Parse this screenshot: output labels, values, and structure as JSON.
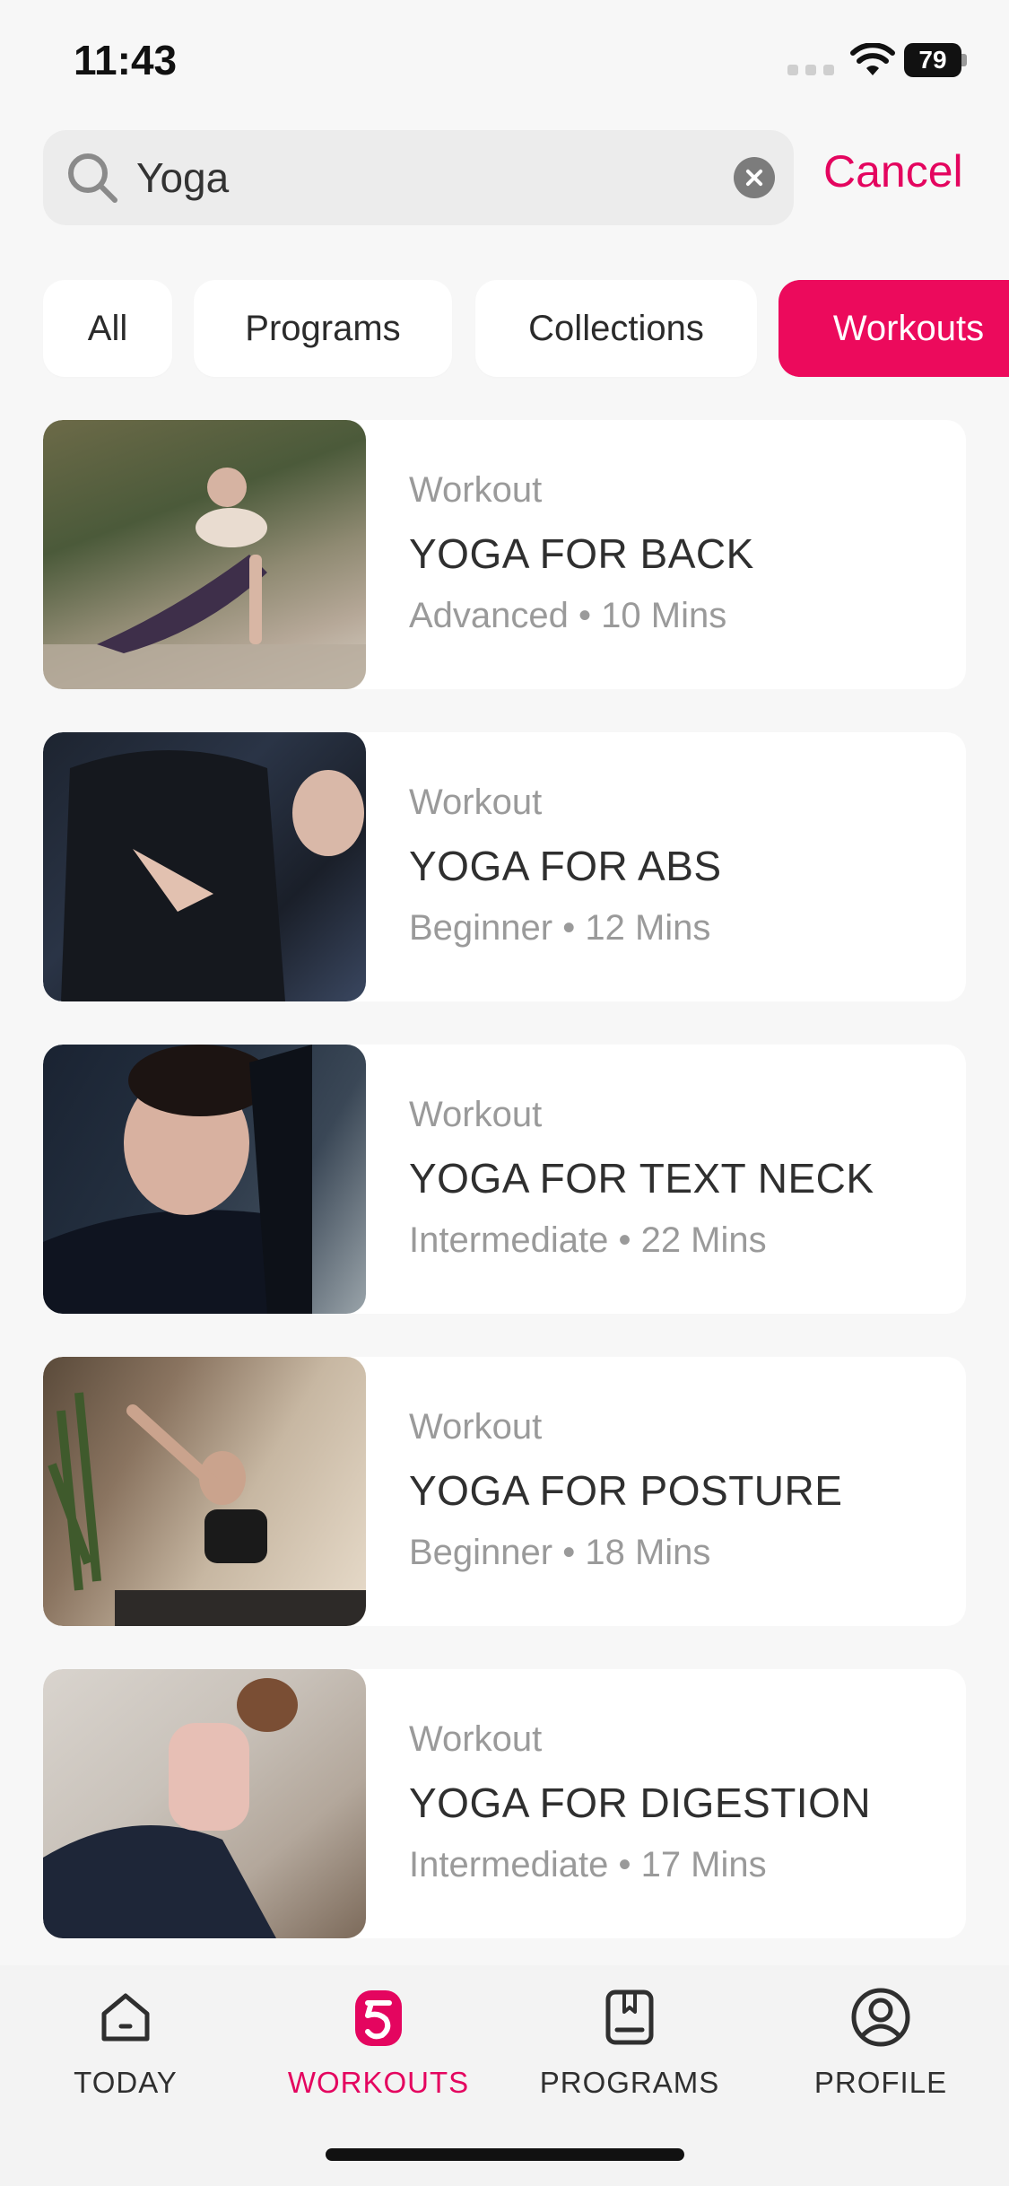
{
  "status": {
    "time": "11:43",
    "battery": "79"
  },
  "search": {
    "value": "Yoga",
    "cancel_label": "Cancel"
  },
  "filters": [
    {
      "label": "All",
      "active": false
    },
    {
      "label": "Programs",
      "active": false
    },
    {
      "label": "Collections",
      "active": false
    },
    {
      "label": "Workouts",
      "active": true
    }
  ],
  "results": [
    {
      "type": "Workout",
      "title": "YOGA FOR BACK",
      "meta": "Advanced • 10 Mins"
    },
    {
      "type": "Workout",
      "title": "YOGA FOR ABS",
      "meta": "Beginner • 12 Mins"
    },
    {
      "type": "Workout",
      "title": "YOGA FOR TEXT NECK",
      "meta": "Intermediate • 22 Mins"
    },
    {
      "type": "Workout",
      "title": "YOGA FOR POSTURE",
      "meta": "Beginner • 18 Mins"
    },
    {
      "type": "Workout",
      "title": "YOGA FOR DIGESTION",
      "meta": "Intermediate • 17 Mins"
    }
  ],
  "nav": [
    {
      "label": "TODAY",
      "icon": "home-icon",
      "active": false
    },
    {
      "label": "WORKOUTS",
      "icon": "workouts-icon",
      "active": true
    },
    {
      "label": "PROGRAMS",
      "icon": "programs-icon",
      "active": false
    },
    {
      "label": "PROFILE",
      "icon": "profile-icon",
      "active": false
    }
  ],
  "colors": {
    "accent": "#e4055f",
    "chip_active": "#ec0a5c",
    "background": "#f7f7f7"
  }
}
